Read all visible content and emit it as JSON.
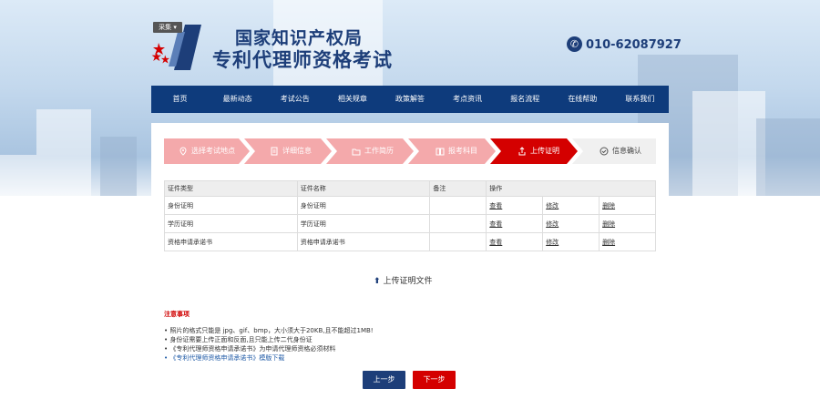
{
  "header": {
    "tag": "采集",
    "title_line1": "国家知识产权局",
    "title_line2": "专利代理师资格考试",
    "phone": "010-62087927"
  },
  "nav": [
    "首页",
    "最新动态",
    "考试公告",
    "相关规章",
    "政策解答",
    "考点资讯",
    "报名流程",
    "在线帮助",
    "联系我们"
  ],
  "steps": [
    {
      "label": "选择考试地点",
      "icon": "location-icon"
    },
    {
      "label": "详细信息",
      "icon": "document-icon"
    },
    {
      "label": "工作简历",
      "icon": "folder-icon"
    },
    {
      "label": "报考科目",
      "icon": "book-icon"
    },
    {
      "label": "上传证明",
      "icon": "upload-icon"
    },
    {
      "label": "信息确认",
      "icon": "check-icon"
    }
  ],
  "colors": {
    "step_done": "#f4a9ab",
    "step_active": "#d40000",
    "step_pending": "#f0f0f0",
    "nav": "#0e3b7c"
  },
  "table": {
    "headers": [
      "证件类型",
      "证件名称",
      "备注",
      "操作"
    ],
    "rows": [
      {
        "type": "身份证明",
        "name": "身份证明",
        "note": "",
        "view": "查看",
        "edit": "修改",
        "del": "删除"
      },
      {
        "type": "学历证明",
        "name": "学历证明",
        "note": "",
        "view": "查看",
        "edit": "修改",
        "del": "删除"
      },
      {
        "type": "资格申请承诺书",
        "name": "资格申请承诺书",
        "note": "",
        "view": "查看",
        "edit": "修改",
        "del": "删除"
      }
    ]
  },
  "upload_label": "上传证明文件",
  "notice": {
    "title": "注意事项",
    "items": [
      "照片的格式只能是 jpg、gif、bmp，大小须大于20KB,且不能超过1MB!",
      "身份证需要上传正面和反面,且只能上传二代身份证",
      "《专利代理师资格申请承诺书》为申请代理师资格必须材料",
      "《专利代理师资格申请承诺书》模版下载"
    ]
  },
  "buttons": {
    "prev": "上一步",
    "next": "下一步"
  }
}
